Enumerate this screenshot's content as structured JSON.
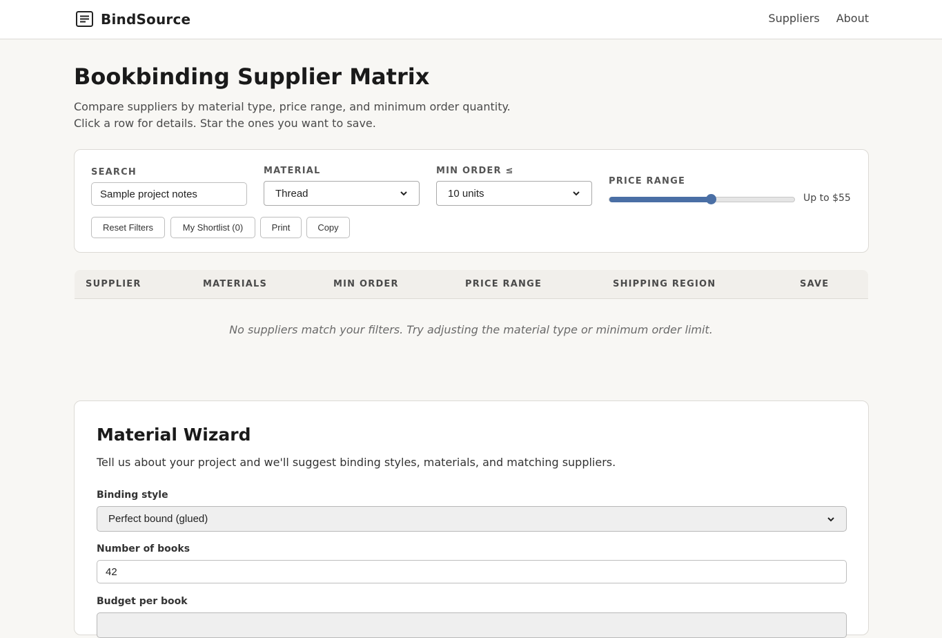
{
  "header": {
    "brand": "BindSource",
    "nav": [
      "Suppliers",
      "About"
    ]
  },
  "page": {
    "title": "Bookbinding Supplier Matrix",
    "intro_line1": "Compare suppliers by material type, price range, and minimum order quantity.",
    "intro_line2": "Click a row for details. Star the ones you want to save."
  },
  "filters": {
    "search_label": "SEARCH",
    "search_value": "Sample project notes",
    "material_label": "MATERIAL",
    "material_value": "Thread",
    "min_order_label": "MIN ORDER ≤",
    "min_order_value": "10 units",
    "price_label": "PRICE RANGE",
    "price_value_text": "Up to $55",
    "price_fraction": 0.55,
    "buttons": [
      "Reset Filters",
      "My Shortlist (0)",
      "Print",
      "Copy"
    ]
  },
  "table": {
    "columns": [
      "SUPPLIER",
      "MATERIALS",
      "MIN ORDER",
      "PRICE RANGE",
      "SHIPPING REGION",
      "SAVE"
    ],
    "empty_message": "No suppliers match your filters. Try adjusting the material type or minimum order limit."
  },
  "wizard": {
    "title": "Material Wizard",
    "description": "Tell us about your project and we'll suggest binding styles, materials, and matching suppliers.",
    "binding_label": "Binding style",
    "binding_value": "Perfect bound (glued)",
    "books_label": "Number of books",
    "books_value": "42",
    "budget_label": "Budget per book"
  },
  "colors": {
    "accent": "#4a6fa5",
    "background": "#f8f7f4"
  },
  "icons": {
    "brand": "document-lines-icon",
    "select": "chevron-down-icon"
  }
}
